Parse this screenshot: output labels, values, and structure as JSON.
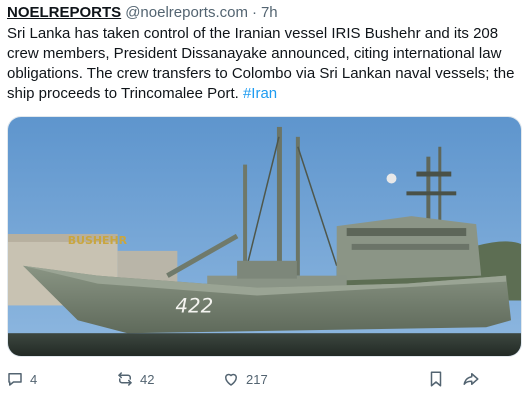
{
  "post": {
    "author_name": "NOELREPORTS",
    "handle": "@noelreports.com",
    "separator": "·",
    "time": "7h",
    "text": "Sri Lanka has taken control of the Iranian vessel IRIS Bushehr and its 208 crew members, President Dissanayake announced, citing international law obligations. The crew transfers to Colombo via Sri Lankan naval vessels; the ship proceeds to Trincomalee Port. ",
    "hashtag": "#Iran",
    "image": {
      "hull_number": "422",
      "bow_lettering": "BUSHEHR"
    }
  },
  "actions": {
    "reply_count": "4",
    "repost_count": "42",
    "like_count": "217"
  },
  "colors": {
    "text": "#0f1419",
    "secondary": "#536471",
    "link": "#1d9bf0",
    "hull": "#7f8a79",
    "sky": "#6b9fd3"
  },
  "icons": [
    "reply-icon",
    "repost-icon",
    "like-icon",
    "bookmark-icon",
    "share-icon"
  ]
}
